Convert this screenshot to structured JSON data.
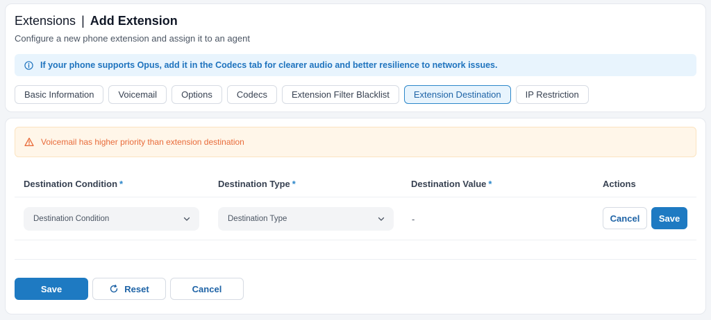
{
  "header": {
    "title": "Extensions",
    "separator": "|",
    "subtitle_title": "Add Extension",
    "description": "Configure a new phone extension and assign it to an agent"
  },
  "info_banner": {
    "icon": "info-icon",
    "text": "If your phone supports Opus, add it in the Codecs tab for clearer audio and better resilience to network issues."
  },
  "tabs": [
    {
      "label": "Basic Information",
      "active": false
    },
    {
      "label": "Voicemail",
      "active": false
    },
    {
      "label": "Options",
      "active": false
    },
    {
      "label": "Codecs",
      "active": false
    },
    {
      "label": "Extension Filter Blacklist",
      "active": false
    },
    {
      "label": "Extension Destination",
      "active": true
    },
    {
      "label": "IP Restriction",
      "active": false
    }
  ],
  "warning_banner": {
    "icon": "warning-icon",
    "text": "Voicemail has higher priority than extension destination"
  },
  "table": {
    "columns": {
      "condition": "Destination Condition",
      "type": "Destination Type",
      "value": "Destination Value",
      "actions": "Actions",
      "required_mark": "*"
    },
    "row": {
      "condition_placeholder": "Destination Condition",
      "type_placeholder": "Destination Type",
      "value": "-",
      "cancel_label": "Cancel",
      "save_label": "Save"
    }
  },
  "footer": {
    "save_label": "Save",
    "reset_label": "Reset",
    "cancel_label": "Cancel"
  },
  "colors": {
    "accent": "#1e7ac2",
    "info_bg": "#e8f4fd",
    "warning_text": "#e86b3a",
    "warning_bg": "#fff6e9"
  }
}
